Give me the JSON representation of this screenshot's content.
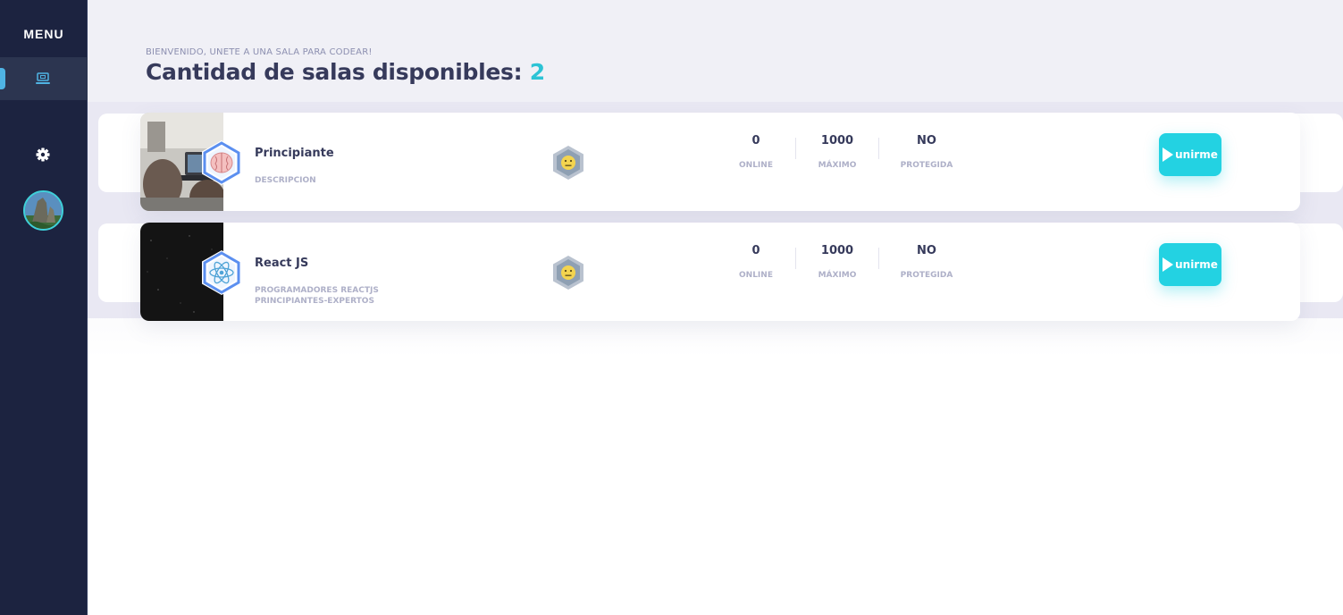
{
  "sidebar": {
    "menu_title": "MENU",
    "nav_items": [
      {
        "icon": "laptop-icon",
        "active": true
      },
      {
        "icon": "gear-icon",
        "active": false
      }
    ],
    "avatar": "user-avatar"
  },
  "header": {
    "welcome": "BIENVENIDO, UNETE A UNA SALA PARA CODEAR!",
    "title_prefix": "Cantidad de salas disponibles:",
    "room_count": "2"
  },
  "rooms": [
    {
      "name": "Principiante",
      "description": "DESCRIPCION",
      "icon": "brain-icon",
      "level_icon": "neutral-face-icon",
      "stats": {
        "online_value": "0",
        "online_label": "ONLINE",
        "max_value": "1000",
        "max_label": "MÁXIMO",
        "protected_value": "NO",
        "protected_label": "PROTEGIDA"
      },
      "join_label": "unirme"
    },
    {
      "name": "React JS",
      "description": "PROGRAMADORES REACTJS PRINCIPIANTES-EXPERTOS",
      "icon": "react-atom-icon",
      "level_icon": "neutral-face-icon",
      "stats": {
        "online_value": "0",
        "online_label": "ONLINE",
        "max_value": "1000",
        "max_label": "MÁXIMO",
        "protected_value": "NO",
        "protected_label": "PROTEGIDA"
      },
      "join_label": "unirme"
    }
  ],
  "colors": {
    "sidebar_bg": "#1c2340",
    "accent": "#23d2e2",
    "heading_text": "#363a5b",
    "muted_text": "#aeb0c8"
  }
}
